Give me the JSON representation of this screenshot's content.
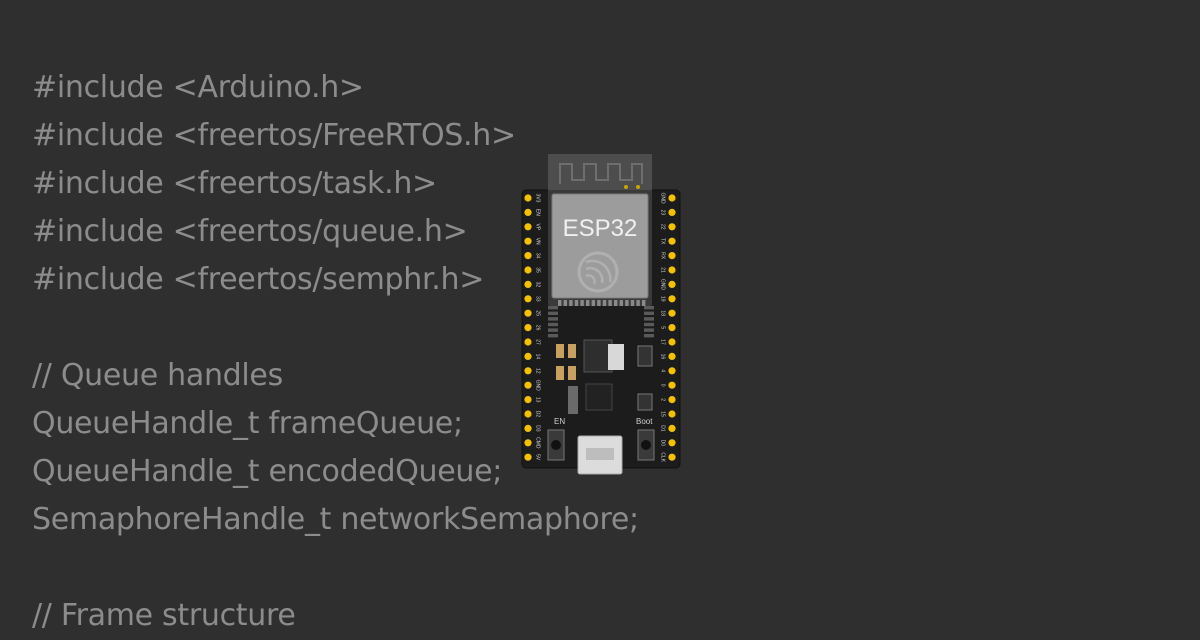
{
  "code": {
    "lines": [
      "#include <Arduino.h>",
      "#include <freertos/FreeRTOS.h>",
      "#include <freertos/task.h>",
      "#include <freertos/queue.h>",
      "#include <freertos/semphr.h>",
      "",
      "// Queue handles",
      "QueueHandle_t frameQueue;",
      "QueueHandle_t encodedQueue;",
      "SemaphoreHandle_t networkSemaphore;",
      "",
      "// Frame structure"
    ]
  },
  "board": {
    "module_label": "ESP32",
    "en_label": "EN",
    "boot_label": "Boot",
    "left_pins": [
      "3V3",
      "EN",
      "VP",
      "VN",
      "34",
      "35",
      "32",
      "33",
      "25",
      "26",
      "27",
      "14",
      "12",
      "GND",
      "13",
      "D2",
      "D3",
      "CMD",
      "5V"
    ],
    "right_pins": [
      "GND",
      "23",
      "22",
      "TX",
      "RX",
      "21",
      "GND",
      "19",
      "18",
      "5",
      "17",
      "16",
      "4",
      "0",
      "2",
      "15",
      "D1",
      "D0",
      "CLK"
    ],
    "colors": {
      "pcb": "#1c1c1c",
      "module_shield": "#9c9c9c",
      "pin_pad": "#f2c400",
      "antenna": "#6e6e6e"
    }
  }
}
